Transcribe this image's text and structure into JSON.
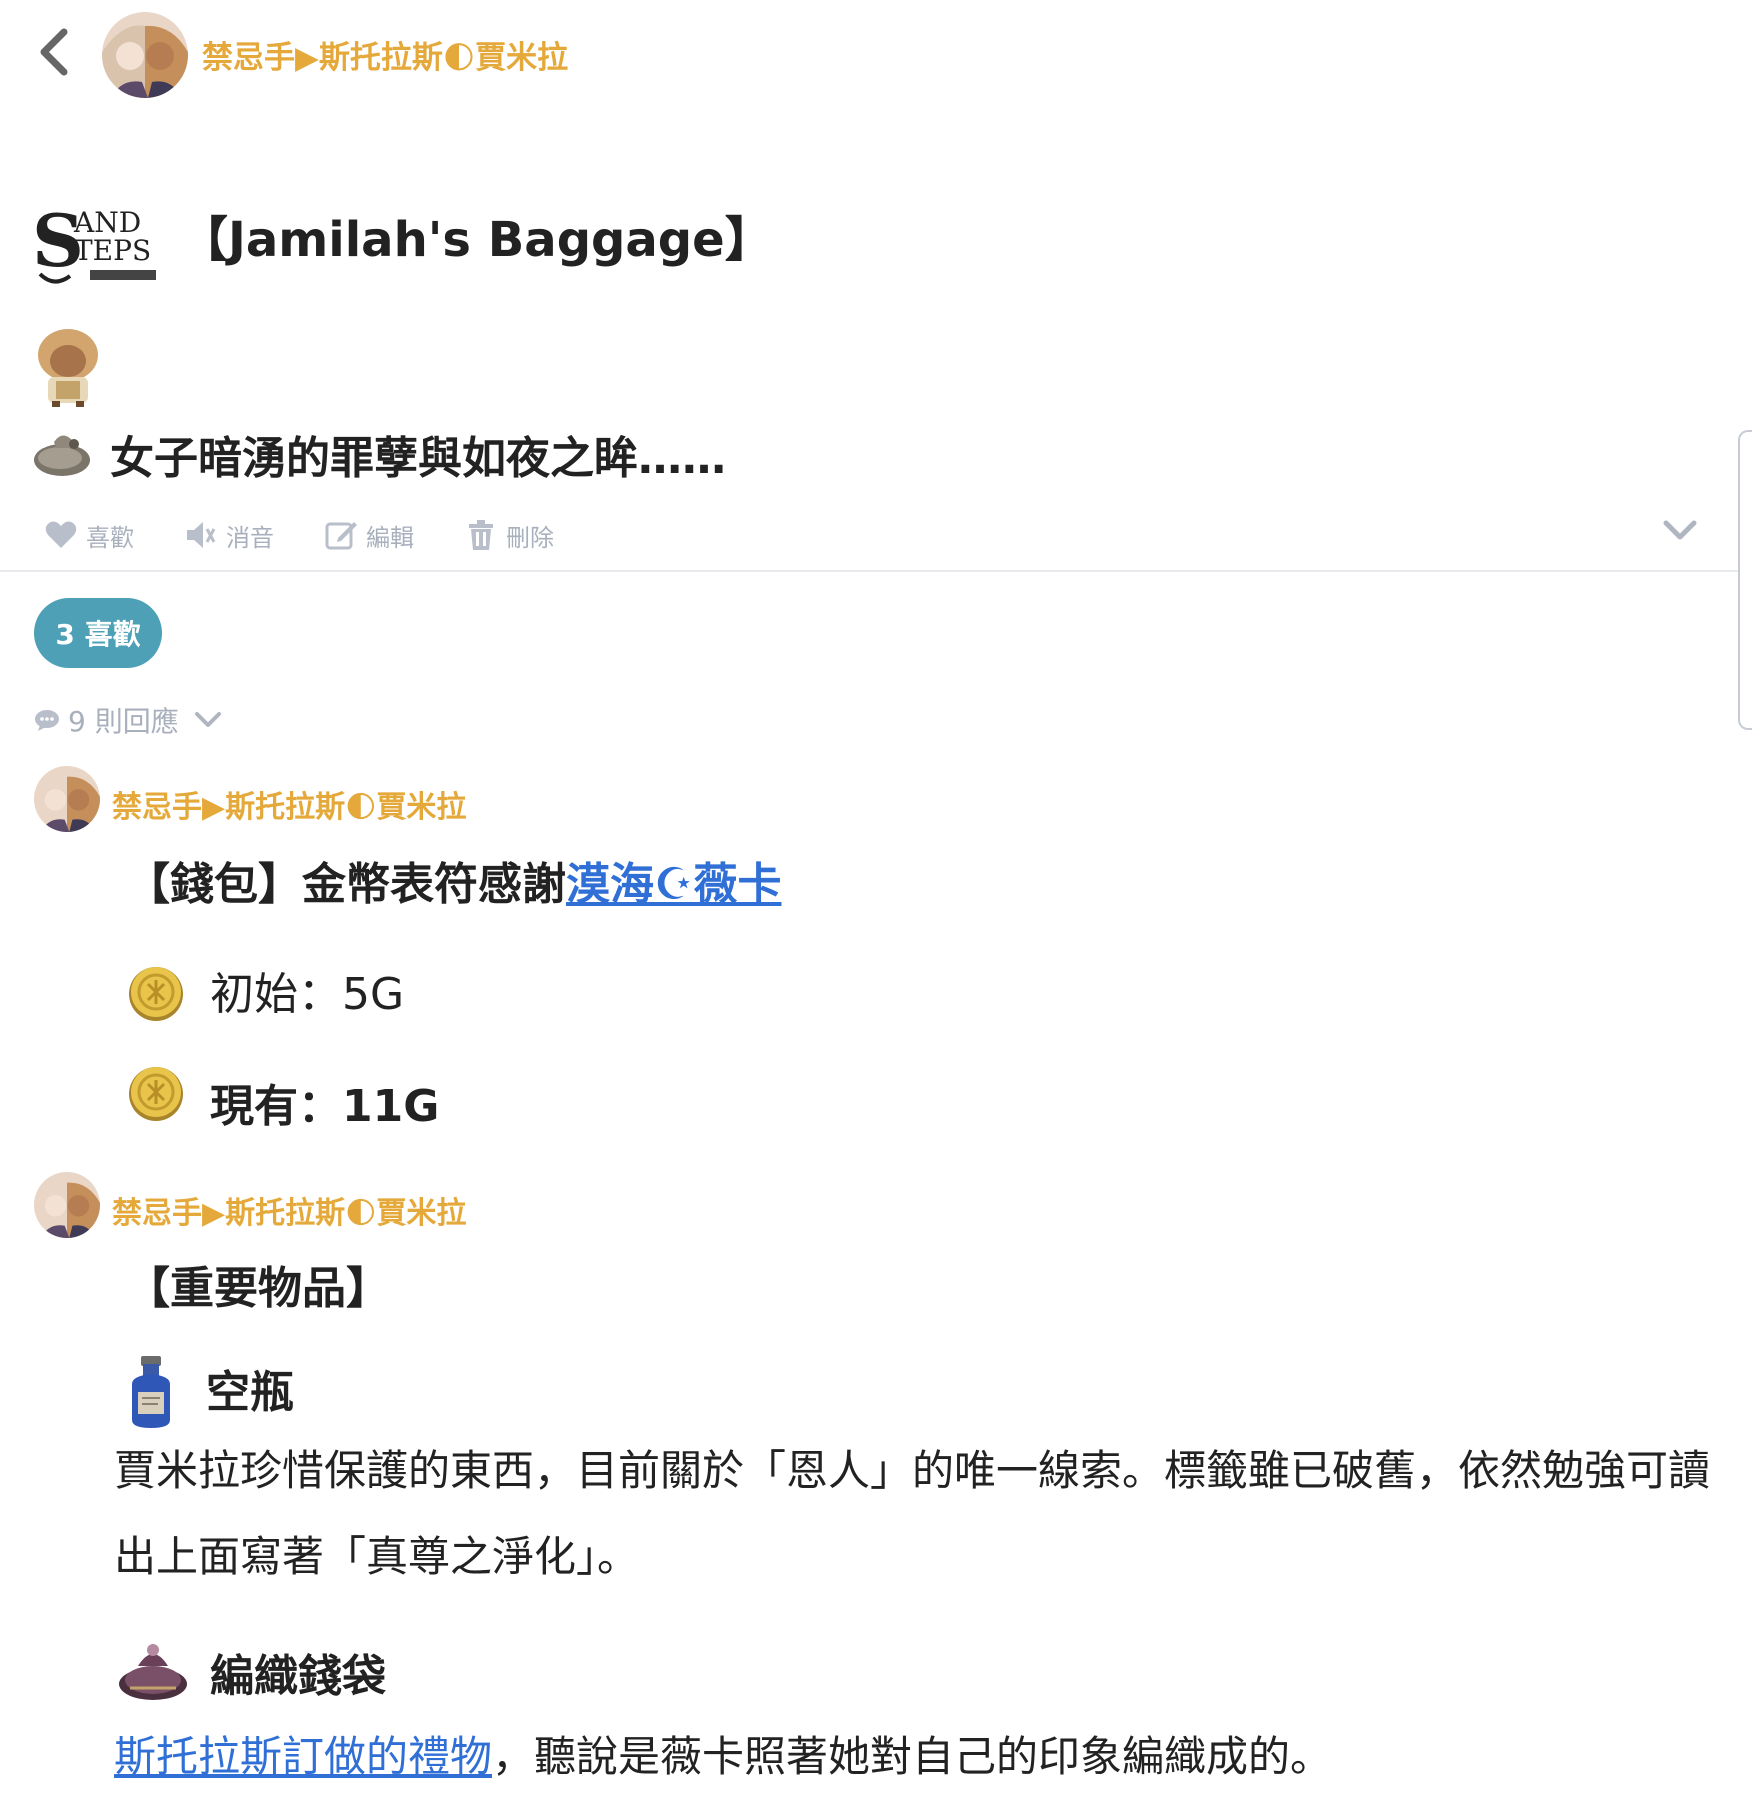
{
  "header": {
    "author_name": "禁忌手▶斯托拉斯🌓賈米拉"
  },
  "post": {
    "title": "【Jamilah's Baggage】",
    "subtitle": "女子暗湧的罪孽與如夜之眸……"
  },
  "actions": {
    "like_label": "喜歡",
    "mute_label": "消音",
    "edit_label": "編輯",
    "delete_label": "刪除"
  },
  "likes_badge": "3 喜歡",
  "replies_label": "9 則回應",
  "reply1": {
    "author_name": "禁忌手▶斯托拉斯🌓賈米拉",
    "wallet_prefix": "【錢包】金幣表符感謝",
    "wallet_link": "漠海☪薇卡",
    "initial_label": "初始：5G",
    "current_label": "現有：11G"
  },
  "reply2": {
    "author_name": "禁忌手▶斯托拉斯🌓賈米拉",
    "section_title": "【重要物品】",
    "items": [
      {
        "icon": "bottle-icon",
        "name": "空瓶",
        "desc": "賈米拉珍惜保護的東西，目前關於「恩人」的唯一線索。標籤雖已破舊，依然勉強可讀出上面寫著「真尊之淨化」。"
      },
      {
        "icon": "woven-purse-icon",
        "name": "編織錢袋",
        "desc_link": "斯托拉斯訂做的禮物",
        "desc_rest": "，聽說是薇卡照著她對自己的印象編織成的。"
      }
    ]
  },
  "colors": {
    "author": "#e4a93a",
    "badge": "#4da0b6",
    "link": "#2f6fd6",
    "muted": "#a9b0bd"
  }
}
